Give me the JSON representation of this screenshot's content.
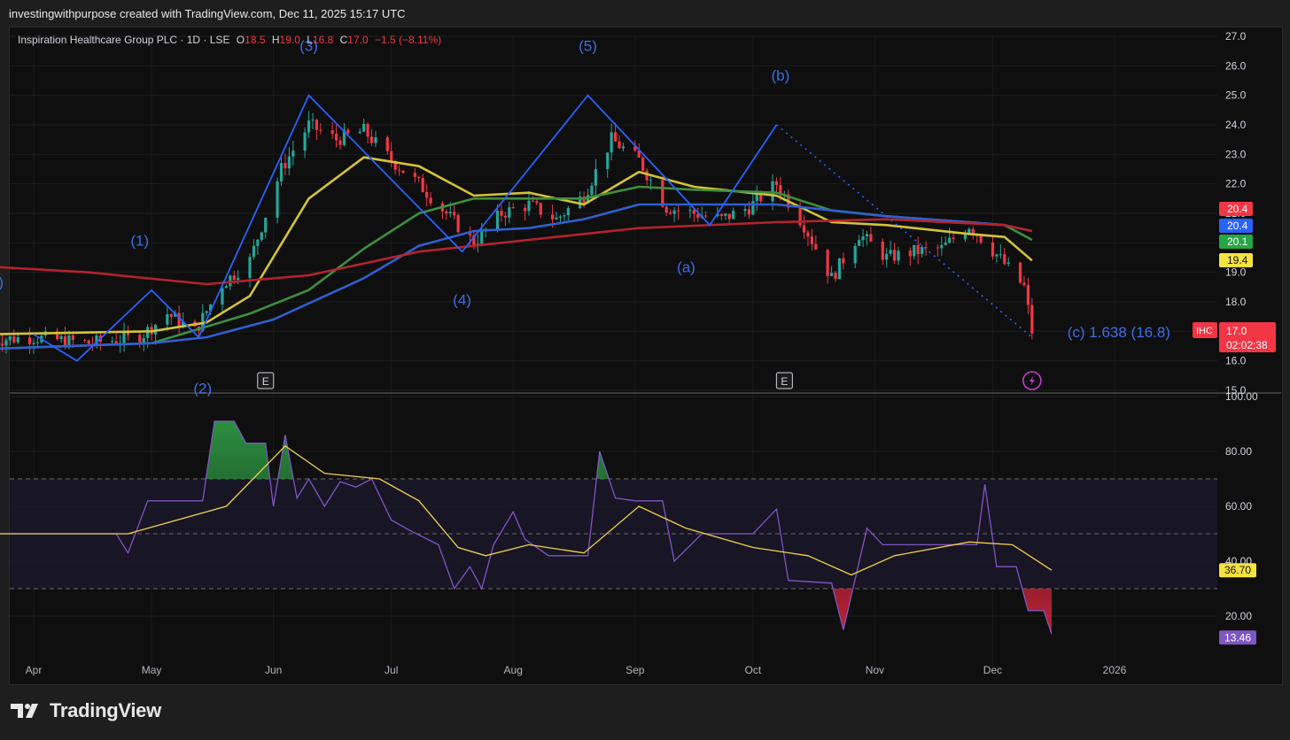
{
  "header": {
    "caption": "investingwithpurpose created with TradingView.com, Dec 11, 2025 15:17 UTC"
  },
  "legend": {
    "title": "Inspiration Healthcare Group PLC · 1D · LSE",
    "o_label": "O",
    "o_value": "18.5",
    "h_label": "H",
    "h_value": "19.0",
    "l_label": "L",
    "l_value": "16.8",
    "c_label": "C",
    "c_value": "17.0",
    "change": "−1.5 (−8.11%)"
  },
  "footer": {
    "brand": "TradingView"
  },
  "colors": {
    "up": "#26a69a",
    "down": "#f23645",
    "wave": "#2962ff",
    "ma_yellow": "#d4c338",
    "ma_green": "#3f8f3f",
    "ma_blue": "#2f5fd0",
    "ma_red": "#b3232f",
    "rsi": "#7e57c2",
    "rsi_ma": "#f0d34a"
  },
  "chart_data": [
    {
      "type": "candlestick",
      "symbol": "IHC",
      "ylim": [
        15.0,
        27.0
      ],
      "y_ticks": [
        "15.0",
        "16.0",
        "17.0",
        "18.0",
        "19.0",
        "20.0",
        "21.0",
        "22.0",
        "23.0",
        "24.0",
        "25.0",
        "26.0",
        "27.0"
      ],
      "x_ticks": [
        "Apr",
        "May",
        "Jun",
        "Jul",
        "Aug",
        "Sep",
        "Oct",
        "Nov",
        "Dec",
        "2026"
      ],
      "close_series": [
        [
          "2025-03-20",
          16.7
        ],
        [
          "2025-04-01",
          16.8
        ],
        [
          "2025-04-15",
          16.6
        ],
        [
          "2025-04-28",
          16.8
        ],
        [
          "2025-05-05",
          17.6
        ],
        [
          "2025-05-12",
          17.0
        ],
        [
          "2025-05-19",
          18.6
        ],
        [
          "2025-05-26",
          19.4
        ],
        [
          "2025-06-03",
          22.5
        ],
        [
          "2025-06-10",
          24.0
        ],
        [
          "2025-06-17",
          23.5
        ],
        [
          "2025-06-24",
          23.8
        ],
        [
          "2025-07-01",
          22.8
        ],
        [
          "2025-07-08",
          22.0
        ],
        [
          "2025-07-15",
          21.0
        ],
        [
          "2025-07-22",
          20.0
        ],
        [
          "2025-07-29",
          21.0
        ],
        [
          "2025-08-05",
          21.3
        ],
        [
          "2025-08-12",
          20.8
        ],
        [
          "2025-08-19",
          21.6
        ],
        [
          "2025-08-26",
          23.5
        ],
        [
          "2025-09-02",
          22.8
        ],
        [
          "2025-09-09",
          21.2
        ],
        [
          "2025-09-16",
          21.0
        ],
        [
          "2025-09-23",
          20.8
        ],
        [
          "2025-09-30",
          21.2
        ],
        [
          "2025-10-07",
          22.0
        ],
        [
          "2025-10-14",
          20.6
        ],
        [
          "2025-10-21",
          18.8
        ],
        [
          "2025-10-28",
          20.3
        ],
        [
          "2025-11-04",
          19.5
        ],
        [
          "2025-11-11",
          19.7
        ],
        [
          "2025-11-18",
          19.8
        ],
        [
          "2025-11-25",
          20.6
        ],
        [
          "2025-12-02",
          19.6
        ],
        [
          "2025-12-09",
          18.5
        ],
        [
          "2025-12-11",
          17.0
        ]
      ],
      "moving_averages": [
        {
          "color": "yellow",
          "points": [
            [
              "2025-03-20",
              16.9
            ],
            [
              "2025-05-01",
              17.0
            ],
            [
              "2025-05-15",
              17.3
            ],
            [
              "2025-05-26",
              18.2
            ],
            [
              "2025-06-10",
              21.5
            ],
            [
              "2025-06-24",
              22.9
            ],
            [
              "2025-07-08",
              22.6
            ],
            [
              "2025-07-22",
              21.6
            ],
            [
              "2025-08-05",
              21.7
            ],
            [
              "2025-08-19",
              21.3
            ],
            [
              "2025-09-02",
              22.4
            ],
            [
              "2025-09-16",
              21.9
            ],
            [
              "2025-09-30",
              21.7
            ],
            [
              "2025-10-07",
              21.6
            ],
            [
              "2025-10-21",
              20.7
            ],
            [
              "2025-11-04",
              20.6
            ],
            [
              "2025-11-25",
              20.3
            ],
            [
              "2025-12-04",
              20.2
            ],
            [
              "2025-12-11",
              19.4
            ]
          ],
          "last": 19.4
        },
        {
          "color": "green",
          "points": [
            [
              "2025-03-20",
              16.4
            ],
            [
              "2025-05-01",
              16.6
            ],
            [
              "2025-05-26",
              17.6
            ],
            [
              "2025-06-10",
              18.4
            ],
            [
              "2025-06-24",
              19.8
            ],
            [
              "2025-07-08",
              21.0
            ],
            [
              "2025-07-22",
              21.5
            ],
            [
              "2025-08-05",
              21.5
            ],
            [
              "2025-08-19",
              21.5
            ],
            [
              "2025-09-02",
              21.9
            ],
            [
              "2025-09-16",
              21.8
            ],
            [
              "2025-10-07",
              21.7
            ],
            [
              "2025-10-21",
              21.1
            ],
            [
              "2025-11-04",
              20.9
            ],
            [
              "2025-11-25",
              20.7
            ],
            [
              "2025-12-04",
              20.6
            ],
            [
              "2025-12-11",
              20.1
            ]
          ],
          "last": 20.1
        },
        {
          "color": "blue",
          "points": [
            [
              "2025-03-20",
              16.4
            ],
            [
              "2025-05-01",
              16.6
            ],
            [
              "2025-05-15",
              16.8
            ],
            [
              "2025-06-01",
              17.4
            ],
            [
              "2025-06-24",
              18.8
            ],
            [
              "2025-07-08",
              19.9
            ],
            [
              "2025-07-22",
              20.4
            ],
            [
              "2025-08-05",
              20.5
            ],
            [
              "2025-08-19",
              20.8
            ],
            [
              "2025-09-02",
              21.3
            ],
            [
              "2025-10-07",
              21.3
            ],
            [
              "2025-10-21",
              21.1
            ],
            [
              "2025-11-04",
              20.9
            ],
            [
              "2025-11-25",
              20.7
            ],
            [
              "2025-12-04",
              20.6
            ],
            [
              "2025-12-11",
              20.4
            ]
          ],
          "last": 20.4
        },
        {
          "color": "red",
          "points": [
            [
              "2025-03-20",
              19.2
            ],
            [
              "2025-04-15",
              19.0
            ],
            [
              "2025-05-15",
              18.6
            ],
            [
              "2025-06-10",
              18.9
            ],
            [
              "2025-07-08",
              19.7
            ],
            [
              "2025-08-05",
              20.1
            ],
            [
              "2025-09-02",
              20.5
            ],
            [
              "2025-10-07",
              20.7
            ],
            [
              "2025-11-04",
              20.8
            ],
            [
              "2025-12-04",
              20.6
            ],
            [
              "2025-12-11",
              20.4
            ]
          ],
          "last": 20.4
        }
      ],
      "wave_path": [
        [
          "2025-04-01",
          16.9
        ],
        [
          "2025-04-12",
          16.0
        ],
        [
          "2025-05-01",
          18.4
        ],
        [
          "2025-05-13",
          16.8
        ],
        [
          "2025-06-10",
          25.0
        ],
        [
          "2025-07-19",
          19.7
        ],
        [
          "2025-08-20",
          25.0
        ],
        [
          "2025-09-20",
          20.6
        ],
        [
          "2025-10-07",
          24.0
        ]
      ],
      "projection": [
        [
          "2025-10-07",
          24.0
        ],
        [
          "2025-12-11",
          16.8
        ]
      ],
      "wave_labels": [
        {
          "text": "(b)",
          "date": "2025-03-22",
          "y": 18.5
        },
        {
          "text": "(1)",
          "date": "2025-04-28",
          "y": 19.9
        },
        {
          "text": "(2)",
          "date": "2025-05-14",
          "y": 14.9
        },
        {
          "text": "(3)",
          "date": "2025-06-10",
          "y": 26.5
        },
        {
          "text": "(4)",
          "date": "2025-07-19",
          "y": 17.9
        },
        {
          "text": "(5)",
          "date": "2025-08-20",
          "y": 26.5
        },
        {
          "text": "(b)",
          "date": "2025-10-08",
          "y": 25.5
        },
        {
          "text": "(a)",
          "date": "2025-09-14",
          "y": 19.0
        },
        {
          "text": "(c) 1.638 (16.8)",
          "date": "2025-12-20",
          "y": 16.8
        }
      ],
      "events": [
        {
          "text": "E",
          "date": "2025-05-30"
        },
        {
          "text": "E",
          "date": "2025-10-09"
        }
      ],
      "price_tags": [
        {
          "value": "20.4",
          "color": "#f23645"
        },
        {
          "value": "20.4",
          "color": "#2962ff"
        },
        {
          "value": "20.1",
          "color": "#26a645"
        },
        {
          "value": "19.4",
          "color": "#f5e342"
        },
        {
          "value": "17.0",
          "extra": "02:02:38",
          "label": "IHC",
          "color": "#f23645"
        }
      ]
    },
    {
      "type": "line",
      "name": "RSI",
      "ylim": [
        0,
        100
      ],
      "y_ticks": [
        "20.00",
        "40.00",
        "60.00",
        "80.00",
        "100.00"
      ],
      "bands": {
        "upper": 70,
        "middle": 50,
        "lower": 30
      },
      "series": [
        {
          "name": "RSI",
          "last": "13.46",
          "points": [
            [
              "2025-03-20",
              50
            ],
            [
              "2025-04-22",
              50
            ],
            [
              "2025-04-25",
              43
            ],
            [
              "2025-04-30",
              62
            ],
            [
              "2025-05-14",
              62
            ],
            [
              "2025-05-17",
              91
            ],
            [
              "2025-05-22",
              91
            ],
            [
              "2025-05-25",
              83
            ],
            [
              "2025-05-30",
              83
            ],
            [
              "2025-06-01",
              60
            ],
            [
              "2025-06-04",
              86
            ],
            [
              "2025-06-07",
              63
            ],
            [
              "2025-06-10",
              70
            ],
            [
              "2025-06-14",
              60
            ],
            [
              "2025-06-18",
              69
            ],
            [
              "2025-06-22",
              67
            ],
            [
              "2025-06-26",
              70
            ],
            [
              "2025-07-01",
              55
            ],
            [
              "2025-07-06",
              51
            ],
            [
              "2025-07-13",
              46
            ],
            [
              "2025-07-17",
              30
            ],
            [
              "2025-07-21",
              38
            ],
            [
              "2025-07-24",
              30
            ],
            [
              "2025-07-27",
              46
            ],
            [
              "2025-08-01",
              58
            ],
            [
              "2025-08-04",
              48
            ],
            [
              "2025-08-10",
              42
            ],
            [
              "2025-08-20",
              42
            ],
            [
              "2025-08-23",
              80
            ],
            [
              "2025-08-27",
              63
            ],
            [
              "2025-09-01",
              62
            ],
            [
              "2025-09-08",
              62
            ],
            [
              "2025-09-11",
              40
            ],
            [
              "2025-09-18",
              50
            ],
            [
              "2025-10-01",
              50
            ],
            [
              "2025-10-07",
              59
            ],
            [
              "2025-10-10",
              33
            ],
            [
              "2025-10-21",
              32
            ],
            [
              "2025-10-24",
              15
            ],
            [
              "2025-10-30",
              52
            ],
            [
              "2025-11-03",
              46
            ],
            [
              "2025-11-27",
              46
            ],
            [
              "2025-11-29",
              68
            ],
            [
              "2025-12-02",
              38
            ],
            [
              "2025-12-07",
              38
            ],
            [
              "2025-12-10",
              22
            ],
            [
              "2025-12-14",
              22
            ],
            [
              "2025-12-16",
              13.46
            ]
          ]
        },
        {
          "name": "RSI-based MA",
          "last": "36.70",
          "points": [
            [
              "2025-03-20",
              50
            ],
            [
              "2025-04-25",
              50
            ],
            [
              "2025-05-20",
              60
            ],
            [
              "2025-06-04",
              82
            ],
            [
              "2025-06-14",
              72
            ],
            [
              "2025-06-28",
              70
            ],
            [
              "2025-07-08",
              62
            ],
            [
              "2025-07-18",
              45
            ],
            [
              "2025-07-25",
              42
            ],
            [
              "2025-08-05",
              46
            ],
            [
              "2025-08-19",
              43
            ],
            [
              "2025-09-02",
              60
            ],
            [
              "2025-09-14",
              52
            ],
            [
              "2025-10-01",
              45
            ],
            [
              "2025-10-15",
              42
            ],
            [
              "2025-10-26",
              35
            ],
            [
              "2025-11-06",
              42
            ],
            [
              "2025-11-25",
              47
            ],
            [
              "2025-12-06",
              46
            ],
            [
              "2025-12-16",
              36.7
            ]
          ]
        }
      ]
    }
  ]
}
